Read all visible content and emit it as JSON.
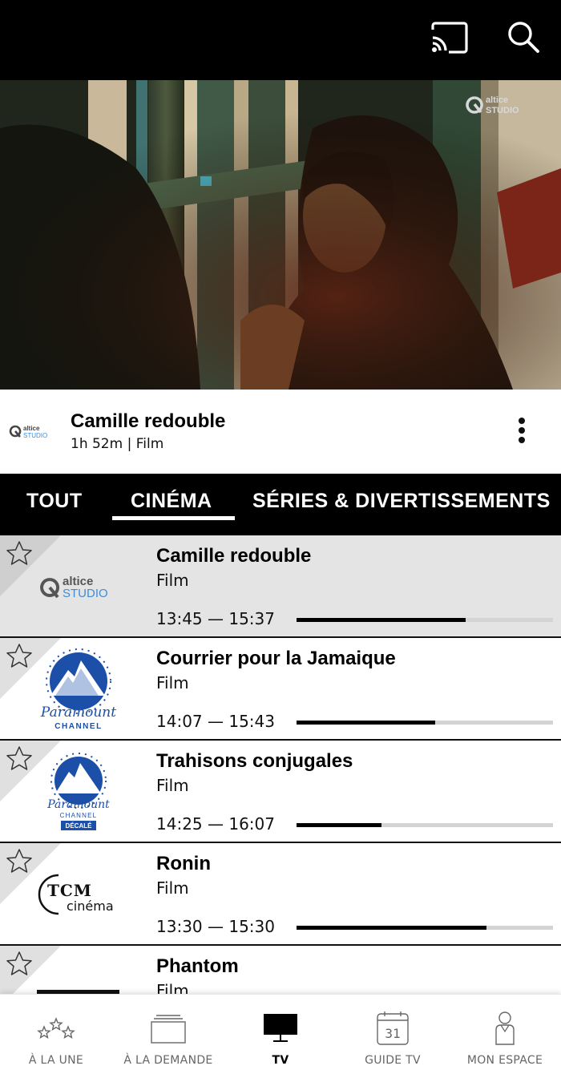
{
  "header": {
    "cast_icon": "cast-icon",
    "search_icon": "search-icon"
  },
  "player": {
    "watermark_brand": "altice STUDIO"
  },
  "now_playing": {
    "channel": "altice STUDIO",
    "title": "Camille redouble",
    "meta": "1h 52m | Film",
    "more_icon": "more-vertical-icon"
  },
  "tabs": [
    {
      "label": "TOUT"
    },
    {
      "label": "CINÉMA",
      "selected": true
    },
    {
      "label": "SÉRIES & DIVERTISSEMENTS"
    }
  ],
  "programs": [
    {
      "channel": "altice STUDIO",
      "title": "Camille redouble",
      "genre": "Film",
      "time": "13:45 — 15:37",
      "progress": 0.66,
      "active": true
    },
    {
      "channel": "Paramount CHANNEL",
      "title": "Courrier pour la Jamaique",
      "genre": "Film",
      "time": "14:07 — 15:43",
      "progress": 0.54,
      "active": false
    },
    {
      "channel": "Paramount CHANNEL DÉCALÉ",
      "title": "Trahisons conjugales",
      "genre": "Film",
      "time": "14:25 — 16:07",
      "progress": 0.33,
      "active": false
    },
    {
      "channel": "TCM cinéma",
      "title": "Ronin",
      "genre": "Film",
      "time": "13:30 — 15:30",
      "progress": 0.74,
      "active": false
    },
    {
      "channel": "",
      "title": "Phantom",
      "genre": "Film",
      "time": "",
      "progress": null,
      "active": false
    }
  ],
  "bottom_nav": [
    {
      "label": "À LA UNE",
      "icon": "stars-icon"
    },
    {
      "label": "À LA DEMANDE",
      "icon": "library-icon"
    },
    {
      "label": "TV",
      "icon": "tv-icon",
      "selected": true
    },
    {
      "label": "GUIDE TV",
      "icon": "calendar-icon",
      "day": "31"
    },
    {
      "label": "MON ESPACE",
      "icon": "person-icon"
    }
  ],
  "colors": {
    "background": "#ffffff",
    "bars": "#000000",
    "active_row": "#e4e4e4",
    "paramount_blue": "#1b4fa8",
    "altice_grey": "#5b5b5b",
    "altice_blue": "#3d8ed8"
  }
}
